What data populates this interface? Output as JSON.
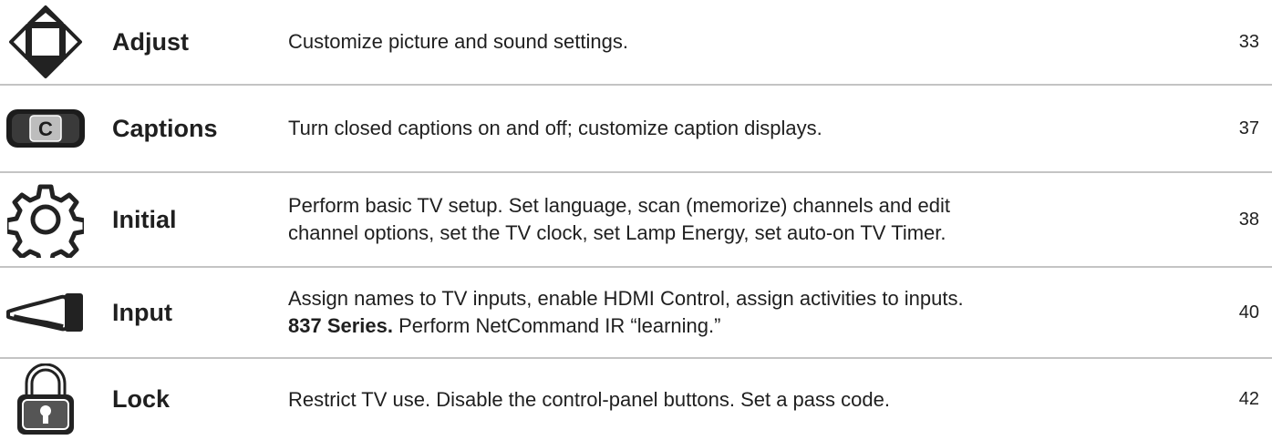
{
  "menu_items": [
    {
      "icon": "adjust-arrows-icon",
      "name": "Adjust",
      "description": "Customize picture and sound settings.",
      "page": "33"
    },
    {
      "icon": "captions-c-icon",
      "name": "Captions",
      "description": "Turn closed captions on and off; customize caption displays.",
      "page": "37"
    },
    {
      "icon": "gear-icon",
      "name": "Initial",
      "description_line1": "Perform basic TV setup.  Set language, scan (memorize) channels and edit",
      "description_line2": "channel options, set the TV clock, set Lamp Energy, set auto-on TV Timer.",
      "page": "38"
    },
    {
      "icon": "input-plug-icon",
      "name": "Input",
      "description_line1": "Assign names to TV inputs, enable HDMI Control, assign activities to inputs.",
      "description_bold": "837 Series.",
      "description_line2_rest": " Perform NetCommand IR “learning.”",
      "page": "40"
    },
    {
      "icon": "padlock-icon",
      "name": "Lock",
      "description": "Restrict TV use.  Disable the control-panel buttons.  Set a pass code.",
      "page": "42"
    }
  ]
}
